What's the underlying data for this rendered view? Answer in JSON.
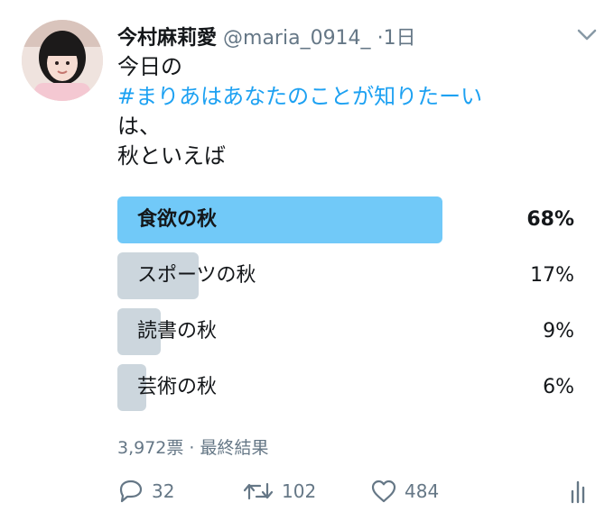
{
  "tweet": {
    "author_name": "今村麻莉愛",
    "author_handle": "@maria_0914_",
    "separator": "·",
    "time": "1日",
    "text_line1": "今日の",
    "hashtag": "#まりあはあなたのことが知りたーい",
    "text_line3": "は、",
    "text_line4": "秋といえば"
  },
  "poll": {
    "options": [
      {
        "label": "食欲の秋",
        "percent_text": "68%",
        "percent": 68,
        "winner": true
      },
      {
        "label": "スポーツの秋",
        "percent_text": "17%",
        "percent": 17,
        "winner": false
      },
      {
        "label": "読書の秋",
        "percent_text": "9%",
        "percent": 9,
        "winner": false
      },
      {
        "label": "芸術の秋",
        "percent_text": "6%",
        "percent": 6,
        "winner": false
      }
    ],
    "meta": "3,972票 · 最終結果"
  },
  "actions": {
    "reply_count": "32",
    "retweet_count": "102",
    "like_count": "484"
  },
  "colors": {
    "accent": "#1da1f2",
    "winner_bar": "#71c9f8",
    "other_bar": "#ccd6dd",
    "secondary_text": "#657786"
  }
}
